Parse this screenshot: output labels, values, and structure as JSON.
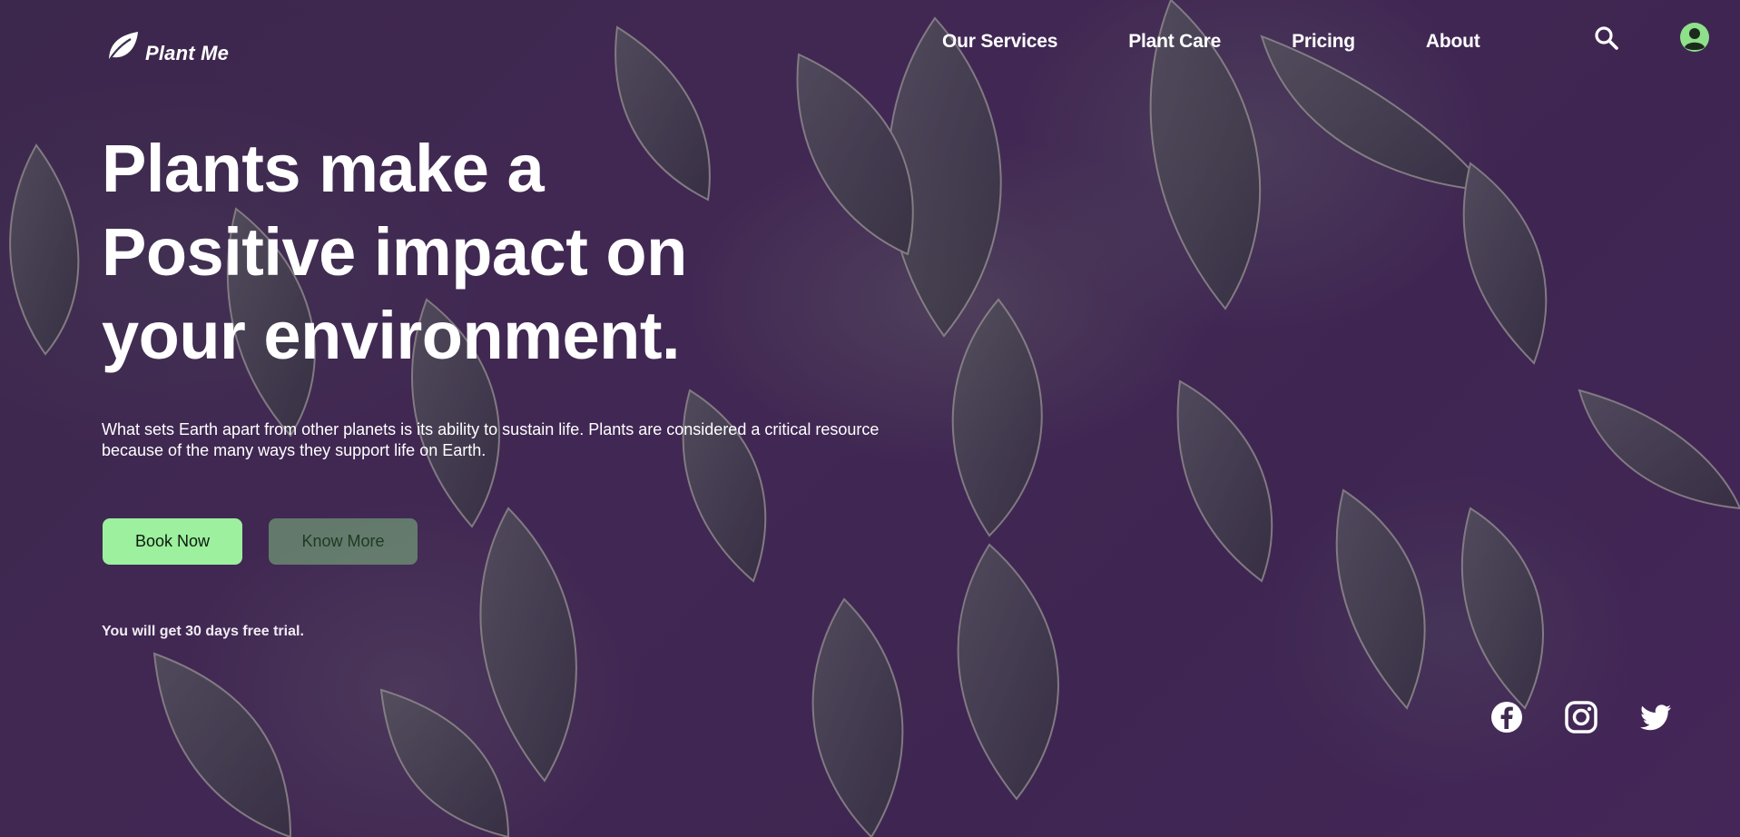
{
  "brand": {
    "name": "Plant Me",
    "logo_icon": "leaf-icon"
  },
  "nav": {
    "links": [
      {
        "label": "Our Services"
      },
      {
        "label": "Plant Care"
      },
      {
        "label": "Pricing"
      },
      {
        "label": "About"
      }
    ],
    "search_icon": "search-icon",
    "account_icon": "user-avatar-icon",
    "account_color": "#8fe08a"
  },
  "hero": {
    "headline_lines": [
      "Plants make a",
      "Positive impact on",
      "your environment."
    ],
    "description": "What sets Earth apart from other planets is its ability to sustain life. Plants are considered a critical resource because of the many ways they support life on Earth.",
    "primary_button": "Book Now",
    "secondary_button": "Know More",
    "trial_note": "You will get 30 days free trial."
  },
  "social": {
    "icons": [
      "facebook-icon",
      "instagram-icon",
      "twitter-icon"
    ]
  },
  "colors": {
    "primary_button_bg": "#9cf09e",
    "overlay_tint": "#46205a"
  }
}
